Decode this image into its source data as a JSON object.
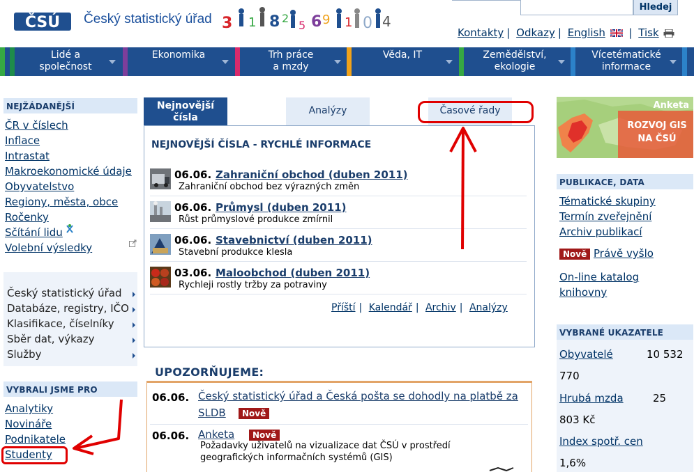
{
  "header": {
    "logo_text": "ČSÚ",
    "site_name": "Český statistický úřad",
    "search_button": "Hledej",
    "links": [
      "Kontakty",
      "Odkazy",
      "English",
      "Tisk"
    ]
  },
  "nav": [
    {
      "line1": "Lidé a",
      "line2": "společnost",
      "accent": "#1e8c4a"
    },
    {
      "line1": "Ekonomika",
      "line2": "",
      "accent": "#7d3e9b"
    },
    {
      "line1": "Trh práce",
      "line2": "a mzdy",
      "accent": "#d82a6c"
    },
    {
      "line1": "Věda, IT",
      "line2": "",
      "accent": "#f0a21a"
    },
    {
      "line1": "Zemědělství,",
      "line2": "ekologie",
      "accent": "#36a843"
    },
    {
      "line1": "Vícetématické",
      "line2": "informace",
      "accent": "#2c82c9"
    }
  ],
  "left": {
    "requested_title": "NEJŽÁDANĚJŠÍ",
    "requested_links": [
      "ČR v číslech",
      "Inflace",
      "Intrastat",
      "Makroekonomické údaje",
      "Obyvatelstvo",
      "Regiony, města, obce",
      "Ročenky",
      "Sčítání lidu",
      "Volební výsledky"
    ],
    "menu": [
      "Český statistický úřad",
      "Databáze, registry, IČO",
      "Klasifikace, číselníky",
      "Sběr dat, výkazy",
      "Služby"
    ],
    "chosen_title": "VYBRALI JSME PRO",
    "chosen_links": [
      "Analytiky",
      "Novináře",
      "Podnikatele",
      "Studenty"
    ]
  },
  "tabs": {
    "active_line1": "Nejnovější",
    "active_line2": "čísla",
    "analyses": "Analýzy",
    "series": "Časové řady"
  },
  "panel": {
    "title": "NEJNOVĚJŠÍ ČÍSLA - RYCHLÉ INFORMACE",
    "news": [
      {
        "date": "06.06.",
        "title": "Zahraniční obchod (duben 2011)",
        "desc": "Zahraniční obchod bez výrazných změn"
      },
      {
        "date": "06.06.",
        "title": "Průmysl (duben 2011)",
        "desc": "Růst průmyslové produkce zmírnil"
      },
      {
        "date": "06.06.",
        "title": "Stavebnictví (duben 2011)",
        "desc": "Stavební produkce klesla"
      },
      {
        "date": "03.06.",
        "title": "Maloobchod (duben 2011)",
        "desc": "Rychleji rostly tržby za potraviny"
      }
    ],
    "footer_links": [
      "Příští",
      "Kalendář",
      "Archiv",
      "Analýzy"
    ]
  },
  "notice": {
    "title": "UPOZORŇUJEME:",
    "items": [
      {
        "date": "06.06.",
        "line1": "Český statistický úřad a Česká pošta se dohodly na platbě za",
        "line2": "SLDB",
        "badge": "Nově"
      },
      {
        "date": "06.06.",
        "link": "Anketa",
        "badge": "Nově",
        "desc1": "Požadavky uživatelů na vizualizace dat ČSÚ v prostředí",
        "desc2": "geografických informačních systémů (GIS)"
      }
    ]
  },
  "right": {
    "banner_label": "Anketa",
    "banner_line1": "ROZVOJ GIS",
    "banner_line2": "NA ČSÚ",
    "pub_title": "PUBLIKACE, DATA",
    "pub_links": [
      "Tématické skupiny",
      "Termín zveřejnění",
      "Archiv publikací"
    ],
    "new_badge": "Nově",
    "new_link": "Právě vyšlo",
    "catalog_line1": "On-line katalog",
    "catalog_line2": "knihovny",
    "ind_title": "VYBRANÉ UKAZATELE",
    "indicators": [
      {
        "name": "Obyvatelé",
        "val_a": "10 532",
        "val_b": "770"
      },
      {
        "name": "Hrubá mzda",
        "val_a": "25",
        "val_b": "803 Kč"
      },
      {
        "name": "Index spotř. cen",
        "val_a": "",
        "val_b": "1,6%"
      }
    ]
  },
  "colors": {
    "nav_blue": "#1f4f8f",
    "annotation_red": "#e00000",
    "badge_red": "#a01818"
  }
}
